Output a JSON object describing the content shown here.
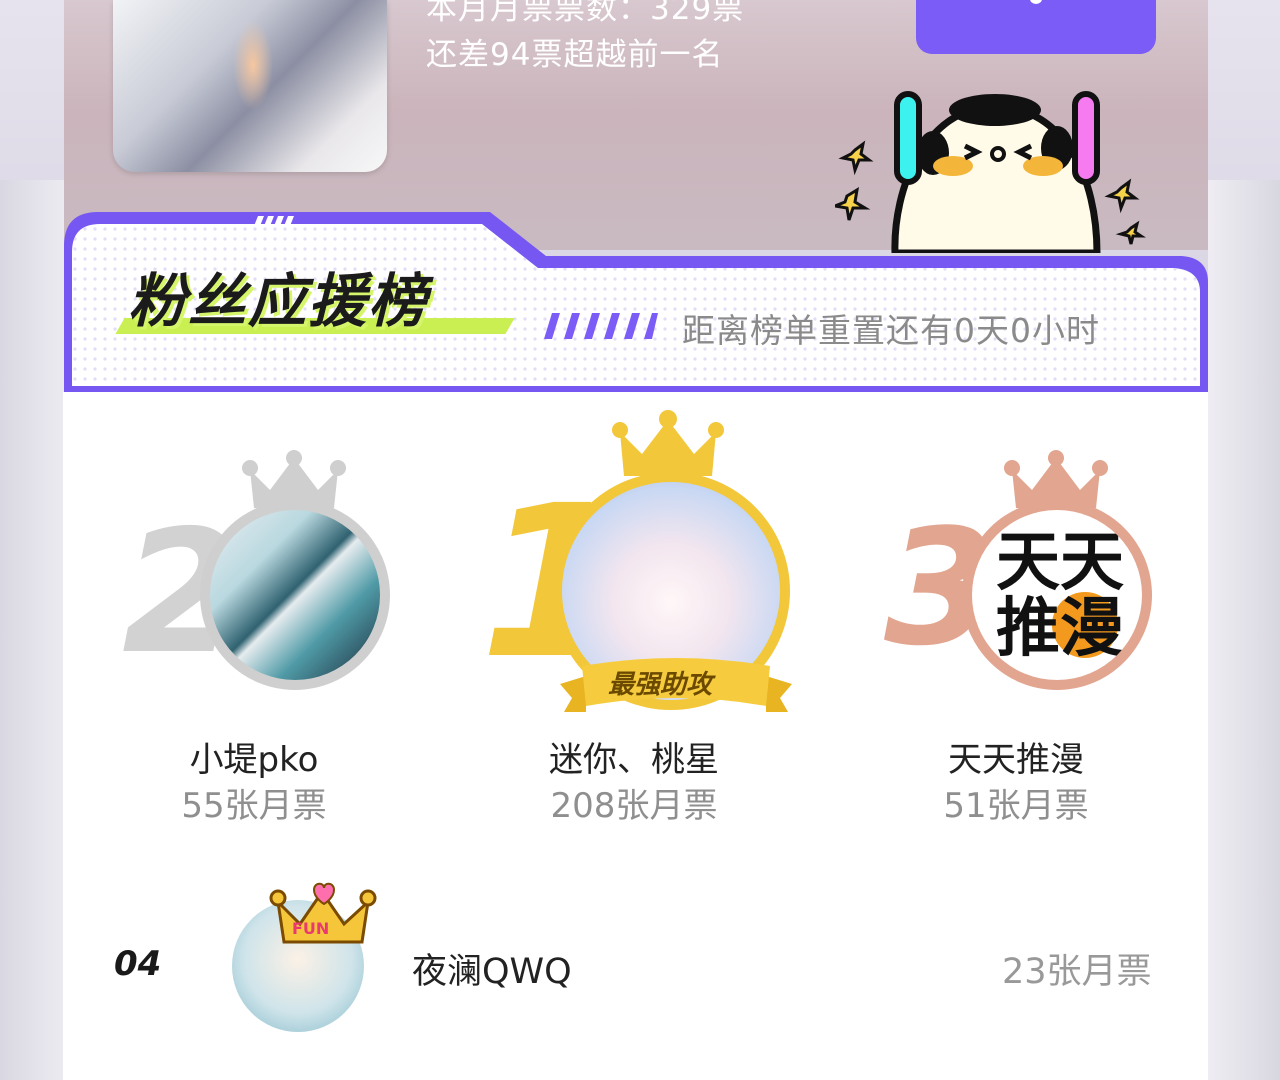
{
  "header": {
    "vote_count_line": "本月月票票数：329票",
    "gap_line": "还差94票超越前一名"
  },
  "board": {
    "title": "粉丝应援榜",
    "reset_info": "距离榜单重置还有0天0小时",
    "strongest_badge": "最强助攻"
  },
  "podium": [
    {
      "rank": "2",
      "name": "小堤pko",
      "votes": "55张月票",
      "crown": "silver-crown-icon"
    },
    {
      "rank": "1",
      "name": "迷你、桃星",
      "votes": "208张月票",
      "crown": "gold-crown-icon"
    },
    {
      "rank": "3",
      "name": "天天推漫",
      "votes": "51张月票",
      "crown": "bronze-crown-icon",
      "avatar_text": "天天推漫"
    }
  ],
  "list": [
    {
      "rank": "04",
      "name": "夜澜QWQ",
      "votes": "23张月票",
      "badge": "FUN"
    }
  ],
  "colors": {
    "accent_purple": "#7c5cf6",
    "lime": "#c9ef53",
    "gold": "#f2c73a",
    "silver": "#c9c9c9",
    "bronze": "#e2a58f"
  }
}
